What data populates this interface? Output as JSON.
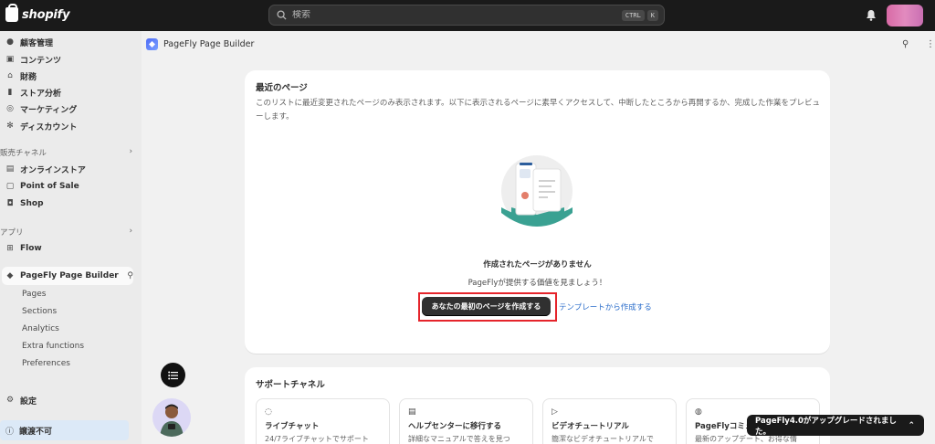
{
  "topbar": {
    "brand": "shopify",
    "search_placeholder": "検索",
    "shortcut_keys": [
      "CTRL",
      "K"
    ],
    "icons": [
      "search-icon",
      "bell-icon"
    ]
  },
  "sidebar": {
    "main_items": [
      {
        "label": "顧客管理",
        "icon": "person-icon"
      },
      {
        "label": "コンテンツ",
        "icon": "image-icon"
      },
      {
        "label": "財務",
        "icon": "bank-icon"
      },
      {
        "label": "ストア分析",
        "icon": "bar-chart-icon"
      },
      {
        "label": "マーケティング",
        "icon": "target-icon"
      },
      {
        "label": "ディスカウント",
        "icon": "discount-icon"
      }
    ],
    "sales_channels_heading": "販売チャネル",
    "sales_channels": [
      {
        "label": "オンラインストア",
        "icon": "store-icon"
      },
      {
        "label": "Point of Sale",
        "icon": "pos-icon"
      },
      {
        "label": "Shop",
        "icon": "shop-icon"
      }
    ],
    "apps_heading": "アプリ",
    "apps": [
      {
        "label": "Flow",
        "icon": "flow-icon"
      }
    ],
    "active_app": "PageFly Page Builder",
    "active_app_subitems": [
      "Pages",
      "Sections",
      "Analytics",
      "Extra functions",
      "Preferences"
    ],
    "settings_label": "設定",
    "warning_label": "譲渡不可"
  },
  "header": {
    "app_title": "PageFly Page Builder"
  },
  "recent_pages": {
    "title": "最近のページ",
    "description": "このリストに最近変更されたページのみ表示されます。以下に表示されるページに素早くアクセスして、中断したところから再開するか、完成した作業をプレビューします。",
    "empty_title": "作成されたページがありません",
    "empty_subtitle": "PageFlyが提供する価値を見ましょう！",
    "primary_button": "あなたの最初のページを作成する",
    "secondary_link": "テンプレートから作成する"
  },
  "support": {
    "title": "サポートチャネル",
    "cards": [
      {
        "title": "ライブチャット",
        "desc": "24/7ライブチャットでサポート",
        "icon": "chat-icon"
      },
      {
        "title": "ヘルプセンターに移行する",
        "desc": "詳細なマニュアルで答えを見つ",
        "icon": "document-icon"
      },
      {
        "title": "ビデオチュートリアル",
        "desc": "簡潔なビデオチュートリアルで",
        "icon": "play-icon"
      },
      {
        "title": "PageFlyコミュ",
        "desc": "最新のアップデート、お得な情",
        "icon": "globe-icon"
      }
    ]
  },
  "toast": {
    "message": "PageFly4.0がアップグレードされました。"
  },
  "colors": {
    "topbar": "#1a1a1a",
    "highlight": "#e5242b",
    "link": "#2c6ecb",
    "teal": "#3aa192"
  }
}
